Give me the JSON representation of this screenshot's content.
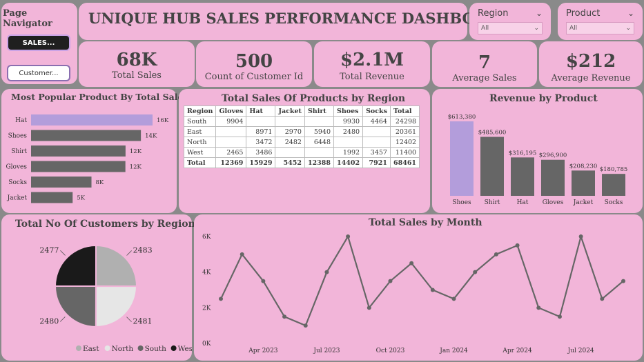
{
  "nav": {
    "title": "Page Navigator",
    "buttons": [
      "SALES...",
      "Customer..."
    ]
  },
  "header": {
    "title": "UNIQUE HUB SALES PERFORMANCE DASHBOARD"
  },
  "filters": [
    {
      "label": "Region",
      "value": "All"
    },
    {
      "label": "Product",
      "value": "All"
    }
  ],
  "kpis": [
    {
      "value": "68K",
      "label": "Total Sales"
    },
    {
      "value": "500",
      "label": "Count of Customer Id"
    },
    {
      "value": "$2.1M",
      "label": "Total Revenue"
    },
    {
      "value": "7",
      "label": "Average Sales"
    },
    {
      "value": "$212",
      "label": "Average Revenue"
    }
  ],
  "colors": {
    "highlight": "#b39ddb",
    "bar": "#666666",
    "background": "#f2b5d9",
    "page": "#8a8a8a"
  },
  "matrix": {
    "title": "Total Sales Of Products by Region",
    "columns": [
      "Region",
      "Gloves",
      "Hat",
      "Jacket",
      "Shirt",
      "Shoes",
      "Socks",
      "Total"
    ],
    "rows": [
      [
        "South",
        "9904",
        "",
        "",
        "",
        "9930",
        "4464",
        "24298"
      ],
      [
        "East",
        "",
        "8971",
        "2970",
        "5940",
        "2480",
        "",
        "20361"
      ],
      [
        "North",
        "",
        "3472",
        "2482",
        "6448",
        "",
        "",
        "12402"
      ],
      [
        "West",
        "2465",
        "3486",
        "",
        "",
        "1992",
        "3457",
        "11400"
      ]
    ],
    "total": [
      "Total",
      "12369",
      "15929",
      "5452",
      "12388",
      "14402",
      "7921",
      "68461"
    ]
  },
  "chart_data": [
    {
      "id": "popular",
      "type": "bar",
      "orientation": "horizontal",
      "title": "Most Popular Product By Total Sales",
      "categories": [
        "Hat",
        "Shoes",
        "Shirt",
        "Gloves",
        "Socks",
        "Jacket"
      ],
      "values": [
        15929,
        14402,
        12388,
        12369,
        7921,
        5452
      ],
      "labels": [
        "16K",
        "14K",
        "12K",
        "12K",
        "8K",
        "5K"
      ],
      "highlight_index": 0
    },
    {
      "id": "revenue",
      "type": "bar",
      "title": "Revenue by Product",
      "categories": [
        "Shoes",
        "Shirt",
        "Hat",
        "Gloves",
        "Jacket",
        "Socks"
      ],
      "values": [
        613380,
        485600,
        316195,
        296900,
        208230,
        180785
      ],
      "labels": [
        "$613,380",
        "$485,600",
        "$316,195",
        "$296,900",
        "$208,230",
        "$180,785"
      ],
      "highlight_index": 0
    },
    {
      "id": "customers",
      "type": "pie",
      "title": "Total No Of Customers by Region",
      "categories": [
        "East",
        "North",
        "South",
        "West"
      ],
      "values": [
        2483,
        2481,
        2480,
        2477
      ],
      "colors": [
        "#b0b0b0",
        "#e6e6e6",
        "#666666",
        "#1a1a1a"
      ],
      "legend": "bottom-right"
    },
    {
      "id": "monthly",
      "type": "line",
      "title": "Total Sales by Month",
      "x": [
        "2023-01",
        "2023-02",
        "2023-03",
        "2023-04",
        "2023-05",
        "2023-06",
        "2023-07",
        "2023-08",
        "2023-09",
        "2023-10",
        "2023-11",
        "2023-12",
        "2024-01",
        "2024-02",
        "2024-03",
        "2024-04",
        "2024-05",
        "2024-06",
        "2024-07",
        "2024-08",
        "2024-09"
      ],
      "values": [
        2500,
        5000,
        3500,
        1500,
        1000,
        4000,
        6000,
        2000,
        3500,
        4500,
        3000,
        2500,
        4000,
        5000,
        5500,
        2000,
        1500,
        6000,
        2500,
        3500
      ],
      "x_ticks": [
        "Apr 2023",
        "Jul 2023",
        "Oct 2023",
        "Jan 2024",
        "Apr 2024",
        "Jul 2024"
      ],
      "y_ticks": [
        "0K",
        "2K",
        "4K",
        "6K"
      ],
      "ylim": [
        0,
        6000
      ]
    }
  ]
}
